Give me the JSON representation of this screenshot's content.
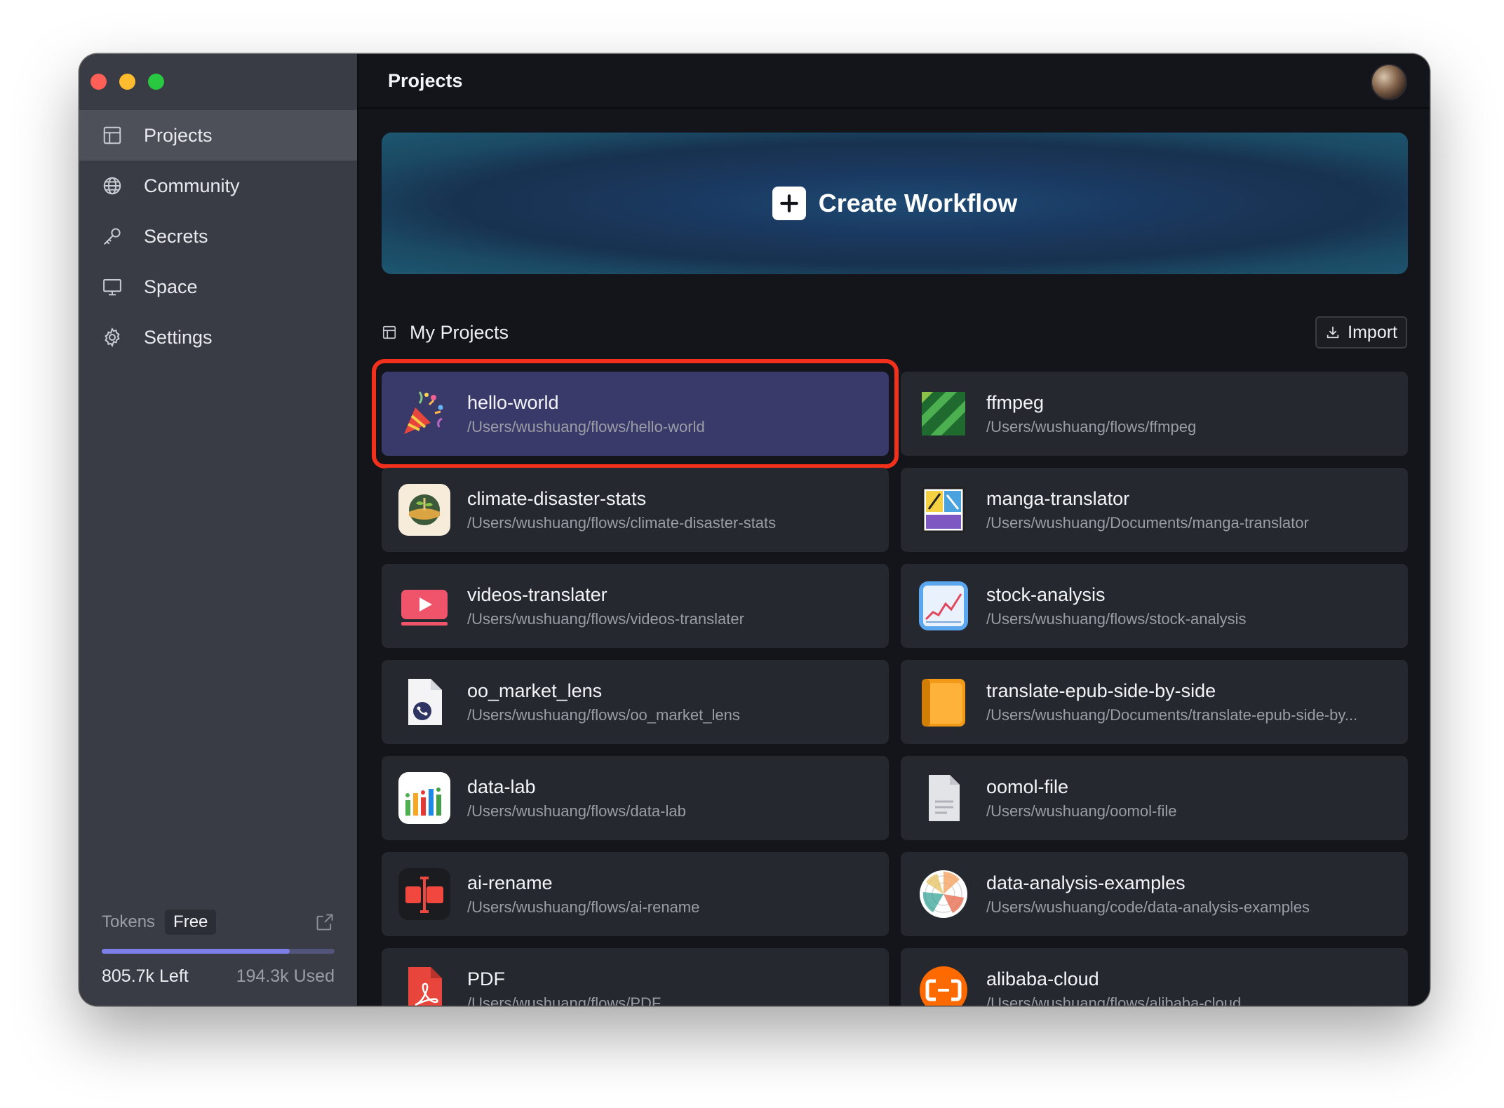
{
  "window": {
    "title": "Projects"
  },
  "sidebar": {
    "items": [
      {
        "label": "Projects",
        "icon": "table-icon",
        "active": true
      },
      {
        "label": "Community",
        "icon": "globe-icon",
        "active": false
      },
      {
        "label": "Secrets",
        "icon": "key-icon",
        "active": false
      },
      {
        "label": "Space",
        "icon": "monitor-icon",
        "active": false
      },
      {
        "label": "Settings",
        "icon": "gear-icon",
        "active": false
      }
    ],
    "tokens": {
      "label": "Tokens",
      "plan": "Free",
      "left": "805.7k Left",
      "used": "194.3k Used",
      "used_fraction": 0.194
    }
  },
  "banner": {
    "label": "Create Workflow"
  },
  "projects_section": {
    "title": "My Projects",
    "import_label": "Import"
  },
  "projects": [
    {
      "name": "hello-world",
      "path": "/Users/wushuang/flows/hello-world",
      "icon": "party-popper-icon",
      "selected": true
    },
    {
      "name": "ffmpeg",
      "path": "/Users/wushuang/flows/ffmpeg",
      "icon": "ffmpeg-logo-icon"
    },
    {
      "name": "climate-disaster-stats",
      "path": "/Users/wushuang/flows/climate-disaster-stats",
      "icon": "earth-plant-icon"
    },
    {
      "name": "manga-translator",
      "path": "/Users/wushuang/Documents/manga-translator",
      "icon": "manga-icon"
    },
    {
      "name": "videos-translater",
      "path": "/Users/wushuang/flows/videos-translater",
      "icon": "video-play-icon"
    },
    {
      "name": "stock-analysis",
      "path": "/Users/wushuang/flows/stock-analysis",
      "icon": "stock-chart-icon"
    },
    {
      "name": "oo_market_lens",
      "path": "/Users/wushuang/flows/oo_market_lens",
      "icon": "flow-file-icon"
    },
    {
      "name": "translate-epub-side-by-side",
      "path": "/Users/wushuang/Documents/translate-epub-side-by...",
      "icon": "book-icon"
    },
    {
      "name": "data-lab",
      "path": "/Users/wushuang/flows/data-lab",
      "icon": "bar-chart-icon"
    },
    {
      "name": "oomol-file",
      "path": "/Users/wushuang/oomol-file",
      "icon": "document-icon"
    },
    {
      "name": "ai-rename",
      "path": "/Users/wushuang/flows/ai-rename",
      "icon": "rename-icon"
    },
    {
      "name": "data-analysis-examples",
      "path": "/Users/wushuang/code/data-analysis-examples",
      "icon": "radar-chart-icon"
    },
    {
      "name": "PDF",
      "path": "/Users/wushuang/flows/PDF",
      "icon": "pdf-icon"
    },
    {
      "name": "alibaba-cloud",
      "path": "/Users/wushuang/flows/alibaba-cloud",
      "icon": "alibaba-cloud-icon"
    }
  ],
  "colors": {
    "accent": "#7b7fe6",
    "selection_outline": "#f2301c",
    "sidebar_bg": "#3a3c45",
    "main_bg": "#13151b",
    "card_bg": "#262830",
    "selected_card_bg": "#3a3a6a"
  }
}
